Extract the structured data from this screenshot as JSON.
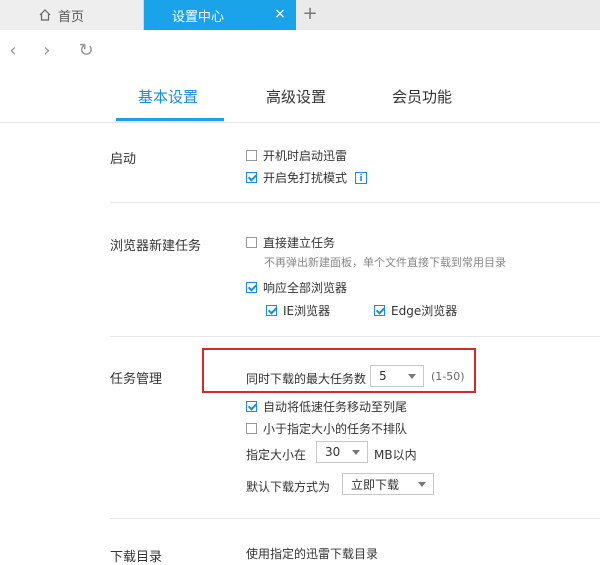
{
  "browser": {
    "tabs": [
      {
        "label": "首页",
        "icon": "home-icon"
      },
      {
        "label": "设置中心",
        "close": "×"
      }
    ],
    "new_tab": "+",
    "nav": {
      "back": "‹",
      "forward": "›",
      "refresh": "↻"
    }
  },
  "settings_tabs": [
    "基本设置",
    "高级设置",
    "会员功能"
  ],
  "sections": {
    "startup": {
      "label": "启动",
      "options": [
        {
          "label": "开机时启动迅雷",
          "checked": false
        },
        {
          "label": "开启免打扰模式",
          "checked": true
        }
      ],
      "info_icon": "i"
    },
    "browser_task": {
      "label": "浏览器新建任务",
      "options": [
        {
          "label": "直接建立任务",
          "checked": false
        },
        {
          "label": "响应全部浏览器",
          "checked": true
        }
      ],
      "hint": "不再弹出新建面板，单个文件直接下载到常用目录",
      "sub_options": [
        {
          "label": "IE浏览器",
          "checked": true
        },
        {
          "label": "Edge浏览器",
          "checked": true
        }
      ]
    },
    "task_mgmt": {
      "label": "任务管理",
      "max_tasks_label": "同时下载的最大任务数",
      "max_tasks_value": "5",
      "max_tasks_range": "(1-50)",
      "options": [
        {
          "label": "自动将低速任务移动至列尾",
          "checked": true
        },
        {
          "label": "小于指定大小的任务不排队",
          "checked": false
        }
      ],
      "size_label": "指定大小在",
      "size_value": "30",
      "size_unit": "MB以内",
      "mode_label": "默认下载方式为",
      "mode_value": "立即下载"
    },
    "download_dir": {
      "label": "下载目录",
      "text": "使用指定的迅雷下载目录"
    }
  },
  "colors": {
    "accent": "#1aa3e8",
    "highlight_box": "#d52a2a"
  }
}
